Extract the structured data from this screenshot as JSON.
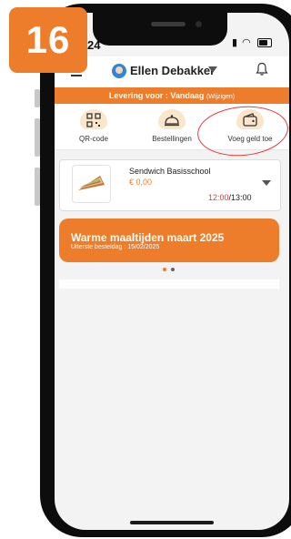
{
  "step_badge": "16",
  "status_bar": {
    "time": "24"
  },
  "header": {
    "user_name": "Ellen Debakker"
  },
  "delivery": {
    "label": "Levering voor : Vandaag",
    "change": "(Wijzigen)"
  },
  "quick_actions": [
    {
      "label": "QR-code",
      "icon": "qr-code-icon"
    },
    {
      "label": "Bestellingen",
      "icon": "cloche-icon"
    },
    {
      "label": "Voeg geld toe",
      "icon": "wallet-icon"
    }
  ],
  "order": {
    "product": "Sendwich Basisschool",
    "price": "€ 0,00",
    "time_start": "12:00",
    "time_end": "/13:00"
  },
  "promo": {
    "title": "Warme maaltijden maart 2025",
    "subtitle": "Uiterste besteldag : 15/02/2025"
  },
  "colors": {
    "brand_orange": "#ed7d2b",
    "highlight_red": "#e53935"
  }
}
